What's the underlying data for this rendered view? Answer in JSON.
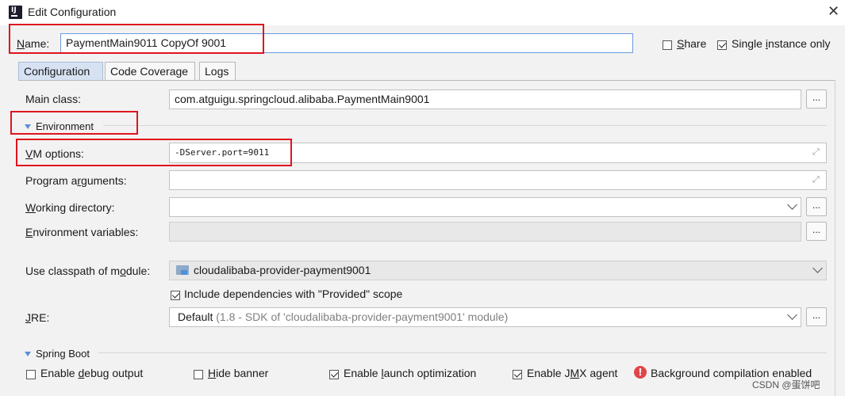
{
  "window": {
    "title": "Edit Configuration",
    "close_glyph": "✕"
  },
  "name_row": {
    "label_prefix": "",
    "label_mnemonic": "N",
    "label_rest": "ame:",
    "value": "PaymentMain9011 CopyOf 9001",
    "share_label": "Share",
    "share_mnemonic": "S",
    "share_rest": "hare",
    "share_checked": false,
    "single_instance_label": "Single instance only",
    "single_instance_pre": "Single ",
    "single_instance_mnemonic": "i",
    "single_instance_post": "nstance only",
    "single_instance_checked": true
  },
  "tabs": [
    {
      "label": "Configuration",
      "active": true
    },
    {
      "label": "Code Coverage",
      "active": false
    },
    {
      "label": "Logs",
      "active": false
    }
  ],
  "main_class": {
    "label": "Main class:",
    "value": "com.atguigu.springcloud.alibaba.PaymentMain9001",
    "button": "..."
  },
  "environment_section": {
    "label": "Environment"
  },
  "vm_options": {
    "label_mnemonic": "V",
    "label_rest": "M options:",
    "value": "-DServer.port=9011"
  },
  "program_arguments": {
    "label_pre": "Program a",
    "label_mnemonic": "r",
    "label_post": "guments:",
    "value": ""
  },
  "working_directory": {
    "label_mnemonic": "W",
    "label_rest": "orking directory:",
    "value": "",
    "button": "..."
  },
  "environment_variables": {
    "label_mnemonic": "E",
    "label_rest": "nvironment variables:",
    "value": "",
    "button": "..."
  },
  "classpath_module": {
    "label_pre": "Use classpath of m",
    "label_mnemonic": "o",
    "label_post": "dule:",
    "value": "cloudalibaba-provider-payment9001"
  },
  "include_provided": {
    "label": "Include dependencies with \"Provided\" scope",
    "checked": true
  },
  "jre": {
    "label_mnemonic": "J",
    "label_rest": "RE:",
    "value_main": "Default",
    "value_detail": "(1.8 - SDK of 'cloudalibaba-provider-payment9001' module)",
    "button": "..."
  },
  "spring_boot_section": {
    "label": "Spring Boot"
  },
  "spring_boot_options": {
    "debug": {
      "pre": "Enable ",
      "mnemonic": "d",
      "post": "ebug output",
      "checked": false
    },
    "hide_banner": {
      "pre": "",
      "mnemonic": "H",
      "post": "ide banner",
      "checked": false
    },
    "launch_opt": {
      "pre": "Enable ",
      "mnemonic": "l",
      "post": "aunch optimization",
      "checked": true
    },
    "jmx": {
      "pre": "Enable J",
      "mnemonic": "M",
      "post": "X agent",
      "checked": true
    },
    "background_compilation": {
      "label": "Background compilation enabled",
      "icon_glyph": "!"
    }
  },
  "watermark": "CSDN @蛋饼吧",
  "colors": {
    "highlight_red": "#e0141e",
    "active_tab": "#d6e2f2",
    "section_triangle": "#5b8fd0"
  }
}
